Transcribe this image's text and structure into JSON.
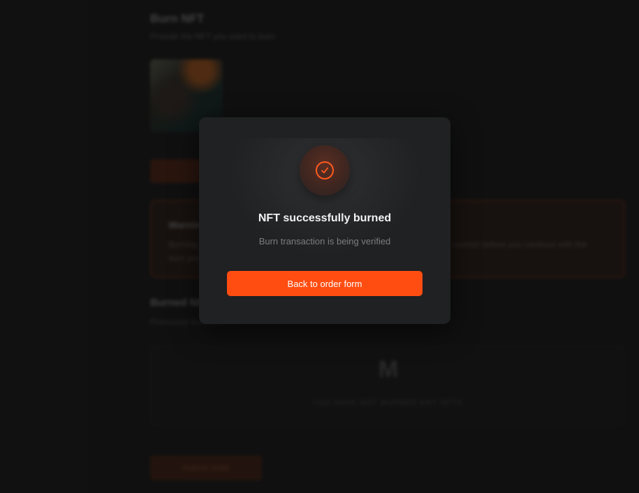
{
  "background": {
    "title": "Burn NFT",
    "subtitle": "Provide the NFT you want to burn",
    "warning_title": "Warning",
    "warning_text": "Burning is permanent and cannot be undone. Make sure the selected NFT is correct before you continue with the burn process.",
    "section_title": "Burned NFTs",
    "section_subtitle": "Previously burned NFTs",
    "empty_text": "YOU HAVE NOT BURNED ANY NFTS",
    "submit_label": "Submit order"
  },
  "modal": {
    "icon": "check-icon",
    "title": "NFT successfully burned",
    "subtitle": "Burn transaction is being verified",
    "button_label": "Back to order form"
  },
  "colors": {
    "accent": "#ff4d12",
    "modal_bg": "#202122",
    "page_bg": "#151515"
  }
}
